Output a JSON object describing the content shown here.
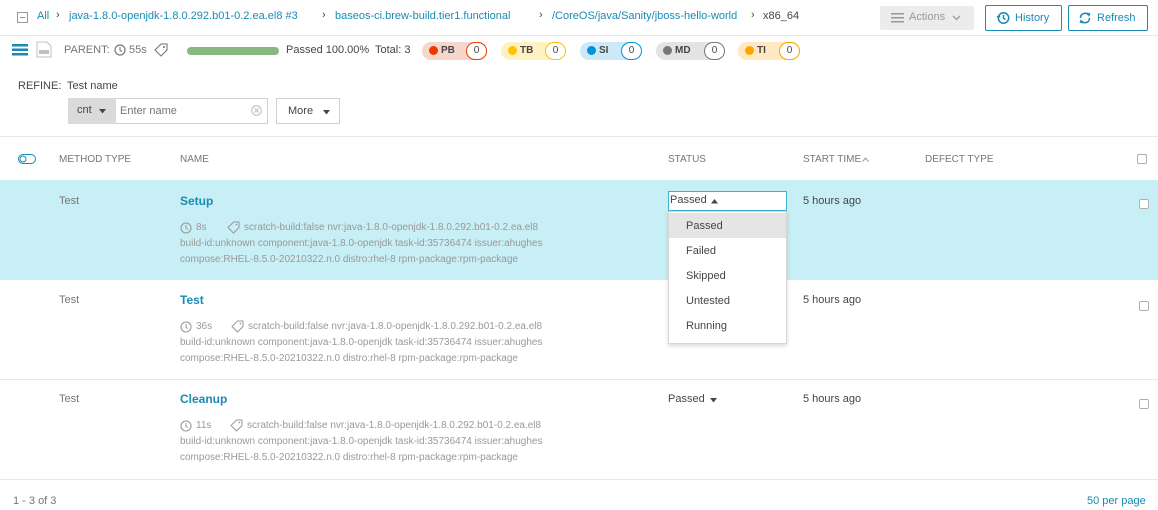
{
  "breadcrumb": {
    "items": [
      "All",
      "java-1.8.0-openjdk-1.8.0.292.b01-0.2.ea.el8 #3",
      "baseos-ci.brew-build.tier1.functional",
      "/CoreOS/java/Sanity/jboss-hello-world"
    ],
    "current": "x86_64"
  },
  "toolbar": {
    "actions_label": "Actions",
    "history_label": "History",
    "refresh_label": "Refresh"
  },
  "launch": {
    "parent_label": "PARENT:",
    "duration": "55s",
    "passed_text": "Passed 100.00%",
    "total_text": "Total: 3",
    "progress_passed_percent": 100,
    "defects": [
      {
        "tag": "PB",
        "count": "0",
        "color": "#ec3900",
        "bg": "#f7d7cc"
      },
      {
        "tag": "TB",
        "count": "0",
        "color": "#ffc208",
        "bg": "#fff1c2"
      },
      {
        "tag": "SI",
        "count": "0",
        "color": "#0392d8",
        "bg": "#cce9f7"
      },
      {
        "tag": "MD",
        "count": "0",
        "color": "#777777",
        "bg": "#e3e3e3"
      },
      {
        "tag": "TI",
        "count": "0",
        "color": "#ffa500",
        "bg": "#ffe8c2"
      }
    ]
  },
  "refine": {
    "label": "REFINE:",
    "filter_name": "Test name",
    "condition": "cnt",
    "placeholder": "Enter name",
    "more_label": "More"
  },
  "table": {
    "headers": {
      "method": "METHOD TYPE",
      "name": "NAME",
      "status": "STATUS",
      "start": "START TIME",
      "defect": "DEFECT TYPE"
    },
    "rows": [
      {
        "method": "Test",
        "name": "Setup",
        "duration": "8s",
        "attr1": "scratch-build:false   nvr:java-1.8.0-openjdk-1.8.0.292.b01-0.2.ea.el8",
        "attr2": "build-id:unknown   component:java-1.8.0-openjdk   task-id:35736474   issuer:ahughes",
        "attr3": "compose:RHEL-8.5.0-20210322.n.0   distro:rhel-8   rpm-package:rpm-package",
        "status": "Passed",
        "start": "5 hours ago"
      },
      {
        "method": "Test",
        "name": "Test",
        "duration": "36s",
        "attr1": "scratch-build:false   nvr:java-1.8.0-openjdk-1.8.0.292.b01-0.2.ea.el8",
        "attr2": "build-id:unknown   component:java-1.8.0-openjdk   task-id:35736474   issuer:ahughes",
        "attr3": "compose:RHEL-8.5.0-20210322.n.0   distro:rhel-8   rpm-package:rpm-package",
        "status": "",
        "start": "5 hours ago"
      },
      {
        "method": "Test",
        "name": "Cleanup",
        "duration": "11s",
        "attr1": "scratch-build:false   nvr:java-1.8.0-openjdk-1.8.0.292.b01-0.2.ea.el8",
        "attr2": "build-id:unknown   component:java-1.8.0-openjdk   task-id:35736474   issuer:ahughes",
        "attr3": "compose:RHEL-8.5.0-20210322.n.0   distro:rhel-8   rpm-package:rpm-package",
        "status": "Passed",
        "start": "5 hours ago"
      }
    ]
  },
  "status_dropdown": {
    "current": "Passed",
    "options": [
      "Passed",
      "Failed",
      "Skipped",
      "Untested",
      "Running"
    ]
  },
  "footer": {
    "range": "1 - 3 of 3",
    "per_page": "50 per page"
  }
}
